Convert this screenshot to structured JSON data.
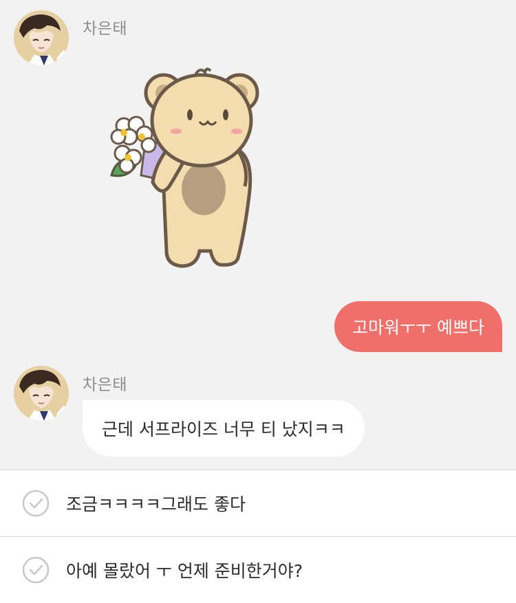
{
  "messages": [
    {
      "sender": "차은태"
    },
    {
      "sender_out_text": "고마워ㅜㅜ 예쁘다"
    },
    {
      "sender": "차은태",
      "text": "근데 서프라이즈 너무 티 났지ㅋㅋ"
    }
  ],
  "sticker": {
    "icon": "bear-with-flowers-icon"
  },
  "choices": [
    {
      "label": "조금ㅋㅋㅋㅋ그래도 좋다",
      "icon": "check-circle-icon"
    },
    {
      "label": "아예 몰랐어 ㅜ 언제 준비한거야?",
      "icon": "check-circle-icon"
    }
  ],
  "colors": {
    "background": "#f2f2f2",
    "outgoing_bubble": "#ef6f6a",
    "incoming_bubble": "#ffffff",
    "sender_text": "#8c8c8c"
  }
}
